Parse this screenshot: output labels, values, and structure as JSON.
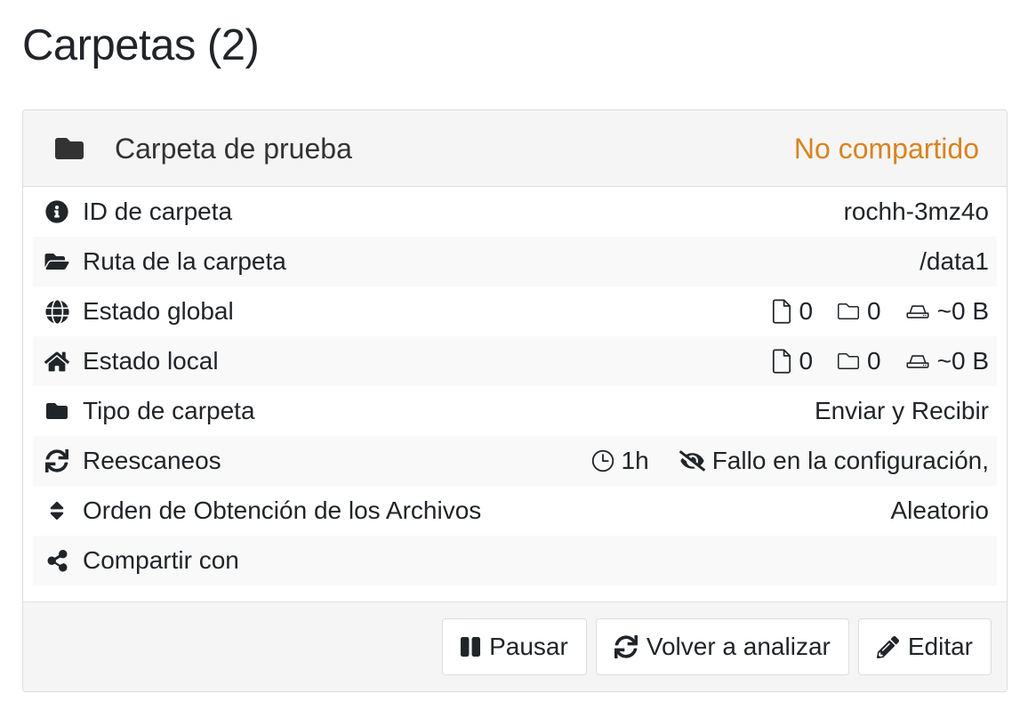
{
  "page_title": "Carpetas (2)",
  "folder_card": {
    "header": {
      "icon": "folder-solid-icon",
      "name": "Carpeta de prueba",
      "status_label": "No compartido",
      "status_color": "#d9831f"
    },
    "rows": [
      {
        "icon": "info-circle-icon",
        "label": "ID de carpeta",
        "value_text": "rochh-3mz4o",
        "kind": "text"
      },
      {
        "icon": "folder-open-icon",
        "label": "Ruta de la carpeta",
        "value_text": "/data1",
        "kind": "text"
      },
      {
        "icon": "globe-icon",
        "label": "Estado global",
        "kind": "metrics",
        "metrics": [
          {
            "icon": "file-icon",
            "text": "0"
          },
          {
            "icon": "folder-outline-icon",
            "text": "0"
          },
          {
            "icon": "hdd-icon",
            "text": "~0 B"
          }
        ]
      },
      {
        "icon": "home-icon",
        "label": "Estado local",
        "kind": "metrics",
        "metrics": [
          {
            "icon": "file-icon",
            "text": "0"
          },
          {
            "icon": "folder-outline-icon",
            "text": "0"
          },
          {
            "icon": "hdd-icon",
            "text": "~0 B"
          }
        ]
      },
      {
        "icon": "folder-solid-icon",
        "label": "Tipo de carpeta",
        "value_text": "Enviar y Recibir",
        "kind": "text"
      },
      {
        "icon": "sync-icon",
        "label": "Reescaneos",
        "kind": "rescan",
        "rescan": [
          {
            "icon": "clock-icon",
            "text": "1h"
          },
          {
            "icon": "eye-slash-icon",
            "text": "Fallo en la configuración,"
          }
        ]
      },
      {
        "icon": "sort-icon",
        "label": "Orden de Obtención de los Archivos",
        "value_text": "Aleatorio",
        "kind": "text"
      },
      {
        "icon": "share-icon",
        "label": "Compartir con",
        "value_text": "",
        "kind": "text"
      }
    ],
    "footer_buttons": [
      {
        "icon": "pause-icon",
        "label": "Pausar"
      },
      {
        "icon": "sync-icon",
        "label": "Volver a analizar"
      },
      {
        "icon": "pencil-icon",
        "label": "Editar"
      }
    ]
  }
}
